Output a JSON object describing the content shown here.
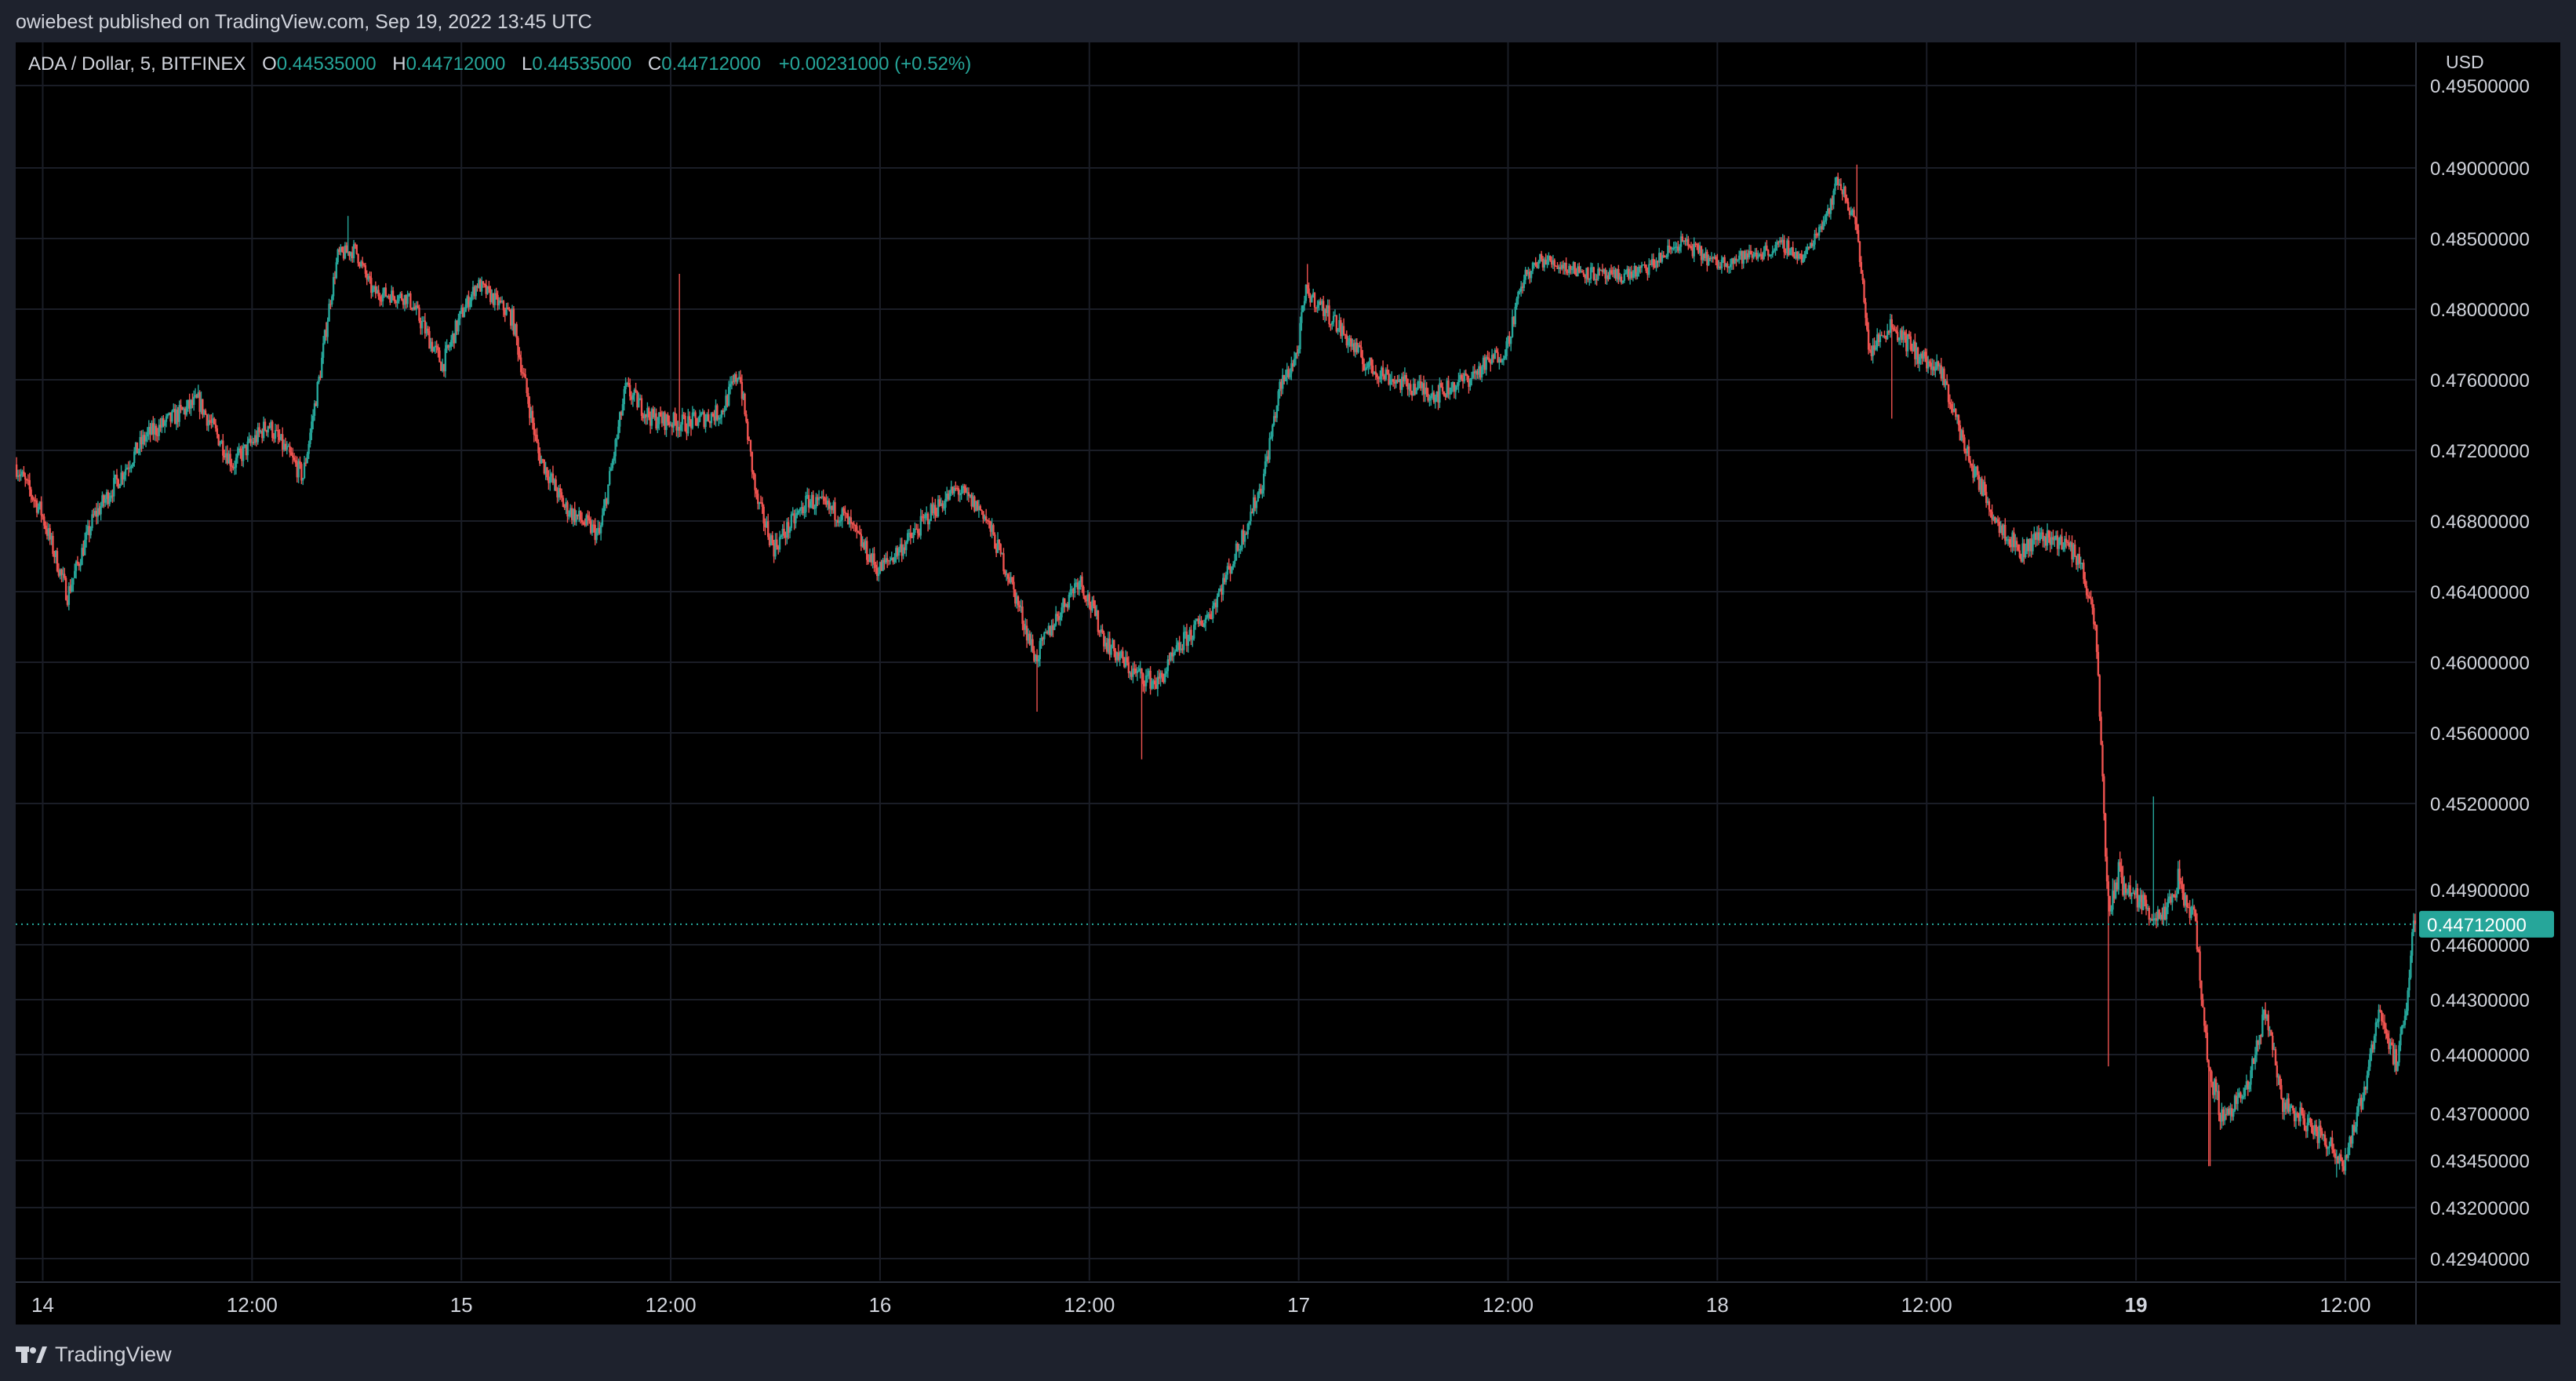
{
  "header": {
    "published": "owiebest published on TradingView.com, Sep 19, 2022 13:45 UTC"
  },
  "legend": {
    "symbol": "ADA / Dollar, 5, BITFINEX",
    "o_label": "O",
    "o_value": "0.44535000",
    "h_label": "H",
    "h_value": "0.44712000",
    "l_label": "L",
    "l_value": "0.44535000",
    "c_label": "C",
    "c_value": "0.44712000",
    "change": "+0.00231000 (+0.52%)"
  },
  "price_axis": {
    "currency": "USD",
    "current_price_label": "0.44712000"
  },
  "footer": {
    "brand": "TradingView",
    "logo_icon": "tradingview-logo-icon"
  },
  "colors": {
    "up": "#26a69a",
    "down": "#ef5350",
    "background": "#000000",
    "frame": "#1e222d",
    "grid": "#1a1d26",
    "text": "#d1d4dc"
  },
  "chart_data": {
    "type": "candlestick",
    "symbol": "ADA / Dollar",
    "interval": "5",
    "exchange": "BITFINEX",
    "x_tick_labels": [
      "14",
      "12:00",
      "15",
      "12:00",
      "16",
      "12:00",
      "17",
      "12:00",
      "18",
      "12:00",
      "19",
      "12:00"
    ],
    "x_tick_hours": [
      0,
      12,
      24,
      36,
      48,
      60,
      72,
      84,
      96,
      108,
      120,
      132
    ],
    "x_range_hours": [
      -1.55,
      136.05
    ],
    "y_tick_labels": [
      "0.49500000",
      "0.49000000",
      "0.48500000",
      "0.48000000",
      "0.47600000",
      "0.47200000",
      "0.46800000",
      "0.46400000",
      "0.46000000",
      "0.45600000",
      "0.45200000",
      "0.44900000",
      "0.44600000",
      "0.44300000",
      "0.44000000",
      "0.43700000",
      "0.43450000",
      "0.43200000",
      "0.42940000"
    ],
    "y_range": [
      0.4285,
      0.4955
    ],
    "grid": true,
    "current_price": 0.44712,
    "price_path": [
      {
        "t": -1.5,
        "p": 0.4712
      },
      {
        "t": 0,
        "p": 0.4685
      },
      {
        "t": 1.5,
        "p": 0.4638
      },
      {
        "t": 3,
        "p": 0.4682
      },
      {
        "t": 6,
        "p": 0.4728
      },
      {
        "t": 9,
        "p": 0.4748
      },
      {
        "t": 11,
        "p": 0.4712
      },
      {
        "t": 13,
        "p": 0.4735
      },
      {
        "t": 15,
        "p": 0.4705
      },
      {
        "t": 16,
        "p": 0.4765
      },
      {
        "t": 17,
        "p": 0.4838
      },
      {
        "t": 18,
        "p": 0.4842
      },
      {
        "t": 19,
        "p": 0.4812
      },
      {
        "t": 21,
        "p": 0.4808
      },
      {
        "t": 23,
        "p": 0.4768
      },
      {
        "t": 24,
        "p": 0.4795
      },
      {
        "t": 25,
        "p": 0.4818
      },
      {
        "t": 27,
        "p": 0.4795
      },
      {
        "t": 28.5,
        "p": 0.4718
      },
      {
        "t": 30,
        "p": 0.4688
      },
      {
        "t": 32,
        "p": 0.4672
      },
      {
        "t": 33.5,
        "p": 0.4755
      },
      {
        "t": 35,
        "p": 0.4738
      },
      {
        "t": 37,
        "p": 0.4735
      },
      {
        "t": 39,
        "p": 0.4742
      },
      {
        "t": 40,
        "p": 0.4765
      },
      {
        "t": 41,
        "p": 0.4692
      },
      {
        "t": 42,
        "p": 0.4665
      },
      {
        "t": 44,
        "p": 0.4692
      },
      {
        "t": 46,
        "p": 0.4683
      },
      {
        "t": 48,
        "p": 0.4652
      },
      {
        "t": 50,
        "p": 0.4672
      },
      {
        "t": 51,
        "p": 0.4685
      },
      {
        "t": 52.5,
        "p": 0.4698
      },
      {
        "t": 54,
        "p": 0.4685
      },
      {
        "t": 55.5,
        "p": 0.4648
      },
      {
        "t": 57,
        "p": 0.4602
      },
      {
        "t": 58,
        "p": 0.4622
      },
      {
        "t": 59.5,
        "p": 0.4648
      },
      {
        "t": 61,
        "p": 0.4612
      },
      {
        "t": 62.5,
        "p": 0.4595
      },
      {
        "t": 64,
        "p": 0.4588
      },
      {
        "t": 65.5,
        "p": 0.4612
      },
      {
        "t": 67,
        "p": 0.4628
      },
      {
        "t": 68.5,
        "p": 0.4662
      },
      {
        "t": 70,
        "p": 0.4702
      },
      {
        "t": 71,
        "p": 0.4755
      },
      {
        "t": 72,
        "p": 0.4775
      },
      {
        "t": 72.5,
        "p": 0.4812
      },
      {
        "t": 74,
        "p": 0.4795
      },
      {
        "t": 76,
        "p": 0.4768
      },
      {
        "t": 78,
        "p": 0.4758
      },
      {
        "t": 80,
        "p": 0.4752
      },
      {
        "t": 82,
        "p": 0.4762
      },
      {
        "t": 84,
        "p": 0.4778
      },
      {
        "t": 85,
        "p": 0.4822
      },
      {
        "t": 86,
        "p": 0.4835
      },
      {
        "t": 88,
        "p": 0.4828
      },
      {
        "t": 90,
        "p": 0.4822
      },
      {
        "t": 92,
        "p": 0.4828
      },
      {
        "t": 94,
        "p": 0.4848
      },
      {
        "t": 96,
        "p": 0.4832
      },
      {
        "t": 98,
        "p": 0.4838
      },
      {
        "t": 100,
        "p": 0.4845
      },
      {
        "t": 101,
        "p": 0.4835
      },
      {
        "t": 102.5,
        "p": 0.4872
      },
      {
        "t": 103,
        "p": 0.4892
      },
      {
        "t": 104,
        "p": 0.4862
      },
      {
        "t": 104.8,
        "p": 0.4775
      },
      {
        "t": 106,
        "p": 0.4792
      },
      {
        "t": 107.5,
        "p": 0.4775
      },
      {
        "t": 109,
        "p": 0.4762
      },
      {
        "t": 110.5,
        "p": 0.4715
      },
      {
        "t": 112,
        "p": 0.4682
      },
      {
        "t": 113.5,
        "p": 0.4662
      },
      {
        "t": 114.5,
        "p": 0.4672
      },
      {
        "t": 116,
        "p": 0.4668
      },
      {
        "t": 117,
        "p": 0.4655
      },
      {
        "t": 117.8,
        "p": 0.4615
      },
      {
        "t": 118.3,
        "p": 0.4505
      },
      {
        "t": 118.6,
        "p": 0.4478
      },
      {
        "t": 119,
        "p": 0.4495
      },
      {
        "t": 120.5,
        "p": 0.4482
      },
      {
        "t": 121.5,
        "p": 0.4472
      },
      {
        "t": 122.5,
        "p": 0.4492
      },
      {
        "t": 123.5,
        "p": 0.4472
      },
      {
        "t": 124.2,
        "p": 0.4395
      },
      {
        "t": 125,
        "p": 0.4368
      },
      {
        "t": 126.5,
        "p": 0.4382
      },
      {
        "t": 127.5,
        "p": 0.4425
      },
      {
        "t": 128.5,
        "p": 0.4375
      },
      {
        "t": 129.5,
        "p": 0.4368
      },
      {
        "t": 131,
        "p": 0.4355
      },
      {
        "t": 132,
        "p": 0.4345
      },
      {
        "t": 133,
        "p": 0.4375
      },
      {
        "t": 134,
        "p": 0.4425
      },
      {
        "t": 135,
        "p": 0.4395
      },
      {
        "t": 135.5,
        "p": 0.4418
      },
      {
        "t": 136,
        "p": 0.44712
      }
    ],
    "notable_wicks": [
      {
        "t": 17.5,
        "p": 0.4866
      },
      {
        "t": 36.5,
        "p": 0.4825
      },
      {
        "t": 57,
        "p": 0.4572
      },
      {
        "t": 63,
        "p": 0.4545
      },
      {
        "t": 72.5,
        "p": 0.4832
      },
      {
        "t": 104,
        "p": 0.4902
      },
      {
        "t": 106,
        "p": 0.4738
      },
      {
        "t": 118.4,
        "p": 0.4394
      },
      {
        "t": 121,
        "p": 0.4524
      },
      {
        "t": 124.2,
        "p": 0.4342
      },
      {
        "t": 131.5,
        "p": 0.4336
      }
    ]
  }
}
